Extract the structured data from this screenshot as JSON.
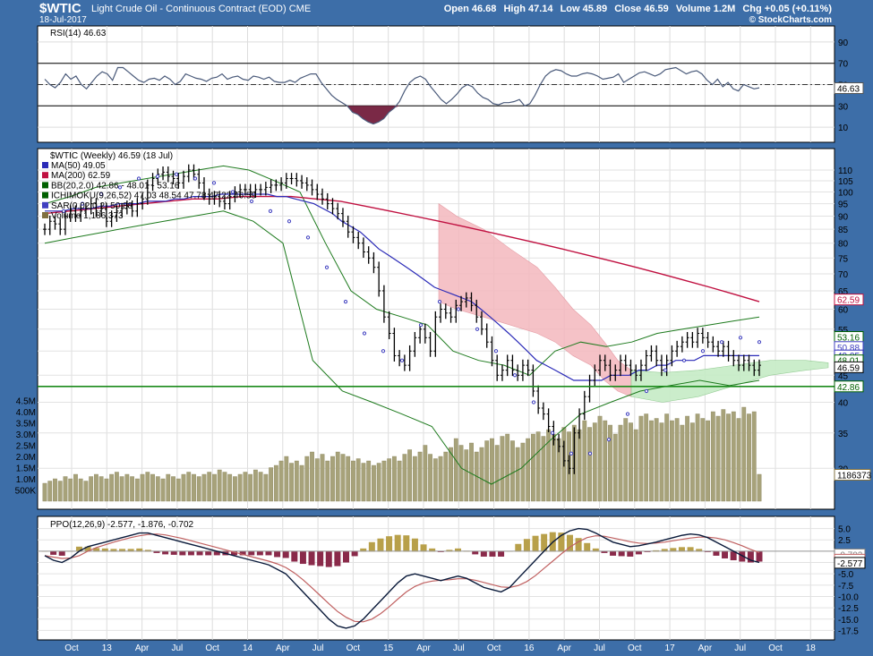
{
  "header": {
    "symbol": "$WTIC",
    "name": "Light Crude Oil - Continuous Contract (EOD)",
    "exchange": "CME",
    "date": "18-Jul-2017",
    "open": "Open 46.68",
    "high": "High 47.14",
    "low": "Low 45.89",
    "close": "Close 46.59",
    "volume": "Volume 1.2M",
    "chg": "Chg +0.05 (+0.11%)",
    "copyright": "© StockCharts.com"
  },
  "panels": {
    "rsi_label": "RSI(14) 46.63",
    "price_label": "$WTIC (Weekly) 46.59 (18 Jul)",
    "ppo_label": "PPO(12,26,9) -2.577, -1.876, -0.702",
    "legend": [
      {
        "text": "MA(50) 49.05",
        "color": "#2b2bb8"
      },
      {
        "text": "MA(200) 62.59",
        "color": "#c01040"
      },
      {
        "text": "BB(20,2.0) 42.86 - 48.01 - 53.16",
        "color": "#006000"
      },
      {
        "text": "ICHIMOKU(9,26,52) 47.03 48.54 47.78 47.22 46.59",
        "color": "#006000"
      },
      {
        "text": "SAR(0.02,0.2) 50.88",
        "color": "#4040c0"
      },
      {
        "text": "Volume 1,186,373",
        "color": "#807040"
      }
    ]
  },
  "chart_data": {
    "type": "line",
    "x_ticks": [
      "Oct",
      "13",
      "Apr",
      "Jul",
      "Oct",
      "14",
      "Apr",
      "Jul",
      "Oct",
      "15",
      "Apr",
      "Jul",
      "Oct",
      "16",
      "Apr",
      "Jul",
      "Oct",
      "17",
      "Apr",
      "Jul",
      "Oct",
      "18"
    ],
    "rsi": {
      "ticks": [
        10,
        30,
        50,
        70,
        90
      ],
      "levels": [
        30,
        70
      ],
      "ylim": [
        0,
        100
      ],
      "last_tag": "46.63",
      "values": [
        55,
        50,
        47,
        52,
        60,
        55,
        58,
        50,
        46,
        52,
        58,
        62,
        60,
        54,
        66,
        66,
        62,
        58,
        54,
        52,
        55,
        56,
        54,
        58,
        55,
        50,
        53,
        60,
        58,
        56,
        55,
        53,
        56,
        57,
        60,
        55,
        57,
        58,
        55,
        54,
        58,
        57,
        55,
        57,
        53,
        52,
        52,
        54,
        52,
        56,
        58,
        60,
        60,
        52,
        46,
        40,
        36,
        33,
        30,
        24,
        22,
        18,
        15,
        13,
        15,
        18,
        24,
        28,
        34,
        44,
        52,
        56,
        58,
        55,
        48,
        42,
        36,
        32,
        36,
        41,
        47,
        50,
        48,
        42,
        38,
        36,
        32,
        31,
        33,
        33,
        34,
        36,
        30,
        32,
        40,
        50,
        58,
        62,
        64,
        63,
        60,
        58,
        58,
        60,
        61,
        60,
        58,
        55,
        56,
        57,
        60,
        52,
        55,
        58,
        61,
        62,
        60,
        58,
        60,
        64,
        65,
        66,
        63,
        60,
        62,
        63,
        60,
        54,
        50,
        55,
        48,
        52,
        46,
        44,
        50,
        48,
        46,
        47
      ],
      "value_label": "46.63"
    },
    "price": {
      "ticks": [
        30,
        35,
        40,
        45,
        50,
        55,
        60,
        65,
        70,
        75,
        80,
        85,
        90,
        95,
        100,
        105,
        110
      ],
      "ylim": [
        26,
        118
      ],
      "close": [
        85,
        88,
        87,
        85,
        90,
        92,
        90,
        92,
        93,
        95,
        92,
        93,
        88,
        90,
        92,
        93,
        94,
        92,
        95,
        97,
        103,
        106,
        108,
        109,
        107,
        106,
        104,
        107,
        110,
        108,
        104,
        99,
        97,
        98,
        96,
        95,
        98,
        100,
        101,
        101,
        100,
        101,
        101,
        102,
        103,
        103,
        104,
        106,
        106,
        105,
        104,
        103,
        101,
        99,
        97,
        95,
        93,
        91,
        88,
        84,
        82,
        80,
        77,
        75,
        72,
        65,
        58,
        54,
        49,
        48,
        47,
        50,
        53,
        55,
        53,
        50,
        58,
        60,
        59,
        58,
        61,
        62,
        63,
        61,
        58,
        55,
        52,
        48,
        45,
        46,
        48,
        46,
        45,
        47,
        46,
        42,
        39,
        38,
        36,
        34,
        33,
        31,
        30,
        35,
        38,
        41,
        44,
        46,
        48,
        47,
        45,
        46,
        48,
        47,
        46,
        45,
        47,
        49,
        50,
        48,
        46,
        48,
        50,
        51,
        52,
        53,
        52,
        54,
        53,
        52,
        51,
        50,
        51,
        49,
        48,
        47,
        48,
        47,
        46,
        47
      ],
      "ma50": [
        92,
        92,
        92,
        93,
        93,
        93,
        94,
        94,
        95,
        95,
        95,
        96,
        96,
        96,
        97,
        97,
        98,
        98,
        98,
        99,
        99,
        99,
        99,
        99,
        99,
        98,
        98,
        97,
        96,
        95,
        93,
        91,
        88,
        86,
        84,
        81,
        78,
        76,
        74,
        72,
        70,
        68,
        66,
        65,
        64,
        63,
        62,
        60,
        58,
        56,
        54,
        52,
        50,
        48,
        47,
        46,
        45,
        44,
        44,
        44,
        44,
        45,
        45,
        45,
        46,
        46,
        47,
        47,
        48,
        48,
        48,
        49,
        49,
        49,
        49,
        49,
        49,
        49
      ],
      "ma200": [
        91,
        92,
        93,
        94,
        95,
        96,
        97,
        97,
        98,
        98,
        98,
        97,
        96,
        94,
        92,
        90,
        88,
        86,
        84,
        82,
        80,
        78,
        76,
        74,
        72,
        70,
        68,
        66,
        64,
        62
      ],
      "bb_upper": [
        95,
        98,
        102,
        104,
        106,
        108,
        110,
        112,
        110,
        105,
        100,
        80,
        65,
        60,
        58,
        56,
        50,
        48,
        47,
        45,
        50,
        52,
        51,
        52,
        54,
        55,
        56,
        57,
        58
      ],
      "bb_lower": [
        80,
        82,
        84,
        86,
        88,
        90,
        92,
        88,
        80,
        48,
        42,
        40,
        38,
        36,
        30,
        28,
        30,
        34,
        38,
        40,
        42,
        43,
        44,
        43,
        44
      ],
      "sar_dots": [
        90,
        92,
        95,
        99,
        102,
        106,
        107,
        108,
        106,
        104,
        100,
        96,
        92,
        88,
        82,
        72,
        62,
        54,
        50,
        48,
        56,
        62,
        60,
        55,
        50,
        45,
        40,
        35,
        32,
        32,
        34,
        38,
        42,
        46,
        48,
        50,
        52,
        53,
        52
      ],
      "hline": 42.86,
      "tags": [
        {
          "value": 62.59,
          "text": "62.59",
          "color": "#c01040"
        },
        {
          "value": 53.16,
          "text": "53.16",
          "color": "#006000"
        },
        {
          "value": 50.88,
          "text": "50.88",
          "color": "#4040c0"
        },
        {
          "value": 49.05,
          "text": "49.05",
          "color": "#2b2bb8"
        },
        {
          "value": 48.01,
          "text": "48.01",
          "color": "#006000"
        },
        {
          "value": 46.59,
          "text": "46.59",
          "color": "#000000"
        },
        {
          "value": 42.86,
          "text": "42.86",
          "color": "#006000"
        }
      ]
    },
    "volume": {
      "ticks": [
        "500K",
        "1.0M",
        "1.5M",
        "2.0M",
        "2.5M",
        "3.0M",
        "3.5M",
        "4.0M",
        "4.5M"
      ],
      "tick_values": [
        0.5,
        1.0,
        1.5,
        2.0,
        2.5,
        3.0,
        3.5,
        4.0,
        4.5
      ],
      "ylim": [
        0,
        4.8
      ],
      "last_tag": "1186373",
      "values": [
        0.8,
        0.9,
        1.0,
        0.9,
        1.1,
        1.0,
        1.2,
        1.0,
        0.9,
        1.1,
        1.2,
        1.1,
        1.0,
        1.2,
        1.3,
        1.1,
        1.2,
        1.1,
        1.0,
        1.2,
        1.3,
        1.2,
        1.1,
        1.0,
        1.2,
        1.1,
        1.0,
        1.2,
        1.3,
        1.2,
        1.1,
        1.2,
        1.3,
        1.2,
        1.4,
        1.3,
        1.2,
        1.1,
        1.2,
        1.3,
        1.2,
        1.4,
        1.3,
        1.2,
        1.5,
        1.6,
        1.8,
        2.0,
        1.7,
        1.8,
        1.6,
        2.0,
        2.2,
        1.9,
        2.1,
        1.8,
        2.0,
        2.2,
        2.1,
        2.0,
        1.8,
        1.9,
        1.7,
        1.8,
        1.6,
        1.7,
        1.8,
        1.9,
        2.0,
        1.8,
        2.1,
        2.3,
        2.0,
        2.2,
        2.5,
        2.1,
        1.9,
        2.0,
        2.2,
        2.4,
        2.8,
        2.5,
        2.3,
        2.6,
        2.2,
        2.4,
        2.7,
        2.8,
        2.5,
        2.9,
        3.0,
        2.7,
        2.4,
        2.6,
        2.8,
        3.0,
        3.1,
        2.9,
        3.2,
        3.0,
        2.8,
        3.3,
        3.1,
        3.4,
        3.2,
        3.6,
        3.3,
        3.5,
        3.8,
        3.6,
        3.4,
        3.0,
        3.4,
        3.7,
        3.5,
        3.2,
        3.8,
        3.9,
        3.6,
        3.7,
        3.5,
        3.9,
        3.6,
        3.7,
        3.4,
        3.8,
        3.5,
        3.9,
        3.7,
        3.6,
        4.0,
        3.8,
        4.1,
        3.9,
        4.0,
        3.7,
        4.2,
        3.9,
        4.0,
        1.2
      ]
    },
    "ppo": {
      "ticks": [
        5.0,
        2.5,
        0.0,
        -2.5,
        -5.0,
        -7.5,
        -10.0,
        -12.5,
        -15.0,
        -17.5
      ],
      "ylim": [
        -19,
        6.5
      ],
      "tags": [
        {
          "value": -0.702,
          "text": "-0.702",
          "color": "#808080"
        },
        {
          "value": -1.876,
          "text": "-1.876",
          "color": "#c06060"
        },
        {
          "value": -2.577,
          "text": "-2.577",
          "color": "#000000"
        }
      ],
      "ppo_line": [
        -1,
        -2,
        -2.5,
        -1.5,
        0,
        1,
        1.5,
        2,
        2.5,
        3,
        3.5,
        4,
        4,
        3.5,
        3,
        2.5,
        2,
        1.5,
        1,
        0.5,
        0,
        -0.5,
        -1,
        -1.5,
        -2,
        -2.5,
        -3,
        -4,
        -5,
        -7,
        -9,
        -11,
        -13,
        -15,
        -16.5,
        -17,
        -16.5,
        -15,
        -13,
        -11,
        -9,
        -7,
        -5.5,
        -5,
        -5.5,
        -6,
        -6.5,
        -6,
        -5.5,
        -6,
        -7,
        -8,
        -8.5,
        -9,
        -8,
        -6,
        -4,
        -2,
        0,
        2,
        3.5,
        4.5,
        5,
        4.8,
        4,
        3,
        2,
        1.5,
        1,
        1.2,
        1.6,
        2,
        2.5,
        3,
        3.5,
        3.8,
        3.6,
        3,
        2,
        1,
        0,
        -1,
        -2,
        -2.5
      ],
      "signal_line": [
        -1,
        -1.3,
        -1.6,
        -1.5,
        -1,
        0,
        0.8,
        1.4,
        2,
        2.5,
        3,
        3.4,
        3.7,
        3.8,
        3.6,
        3.2,
        2.8,
        2.3,
        1.8,
        1.3,
        0.8,
        0.3,
        -0.2,
        -0.7,
        -1.2,
        -1.7,
        -2.2,
        -2.8,
        -3.6,
        -4.8,
        -6.3,
        -8,
        -9.8,
        -11.6,
        -13.3,
        -14.6,
        -15.5,
        -15.6,
        -15,
        -13.8,
        -12.3,
        -10.6,
        -9,
        -7.8,
        -7,
        -6.6,
        -6.4,
        -6.3,
        -6.1,
        -6.1,
        -6.4,
        -6.9,
        -7.4,
        -7.9,
        -8,
        -7.6,
        -6.7,
        -5.4,
        -3.8,
        -2.2,
        -0.6,
        0.9,
        2.1,
        3,
        3.4,
        3.3,
        2.9,
        2.5,
        2.1,
        1.8,
        1.7,
        1.8,
        2,
        2.3,
        2.6,
        2.9,
        3.1,
        3.1,
        2.9,
        2.5,
        1.9,
        1.2,
        0.4,
        -0.3
      ]
    }
  }
}
